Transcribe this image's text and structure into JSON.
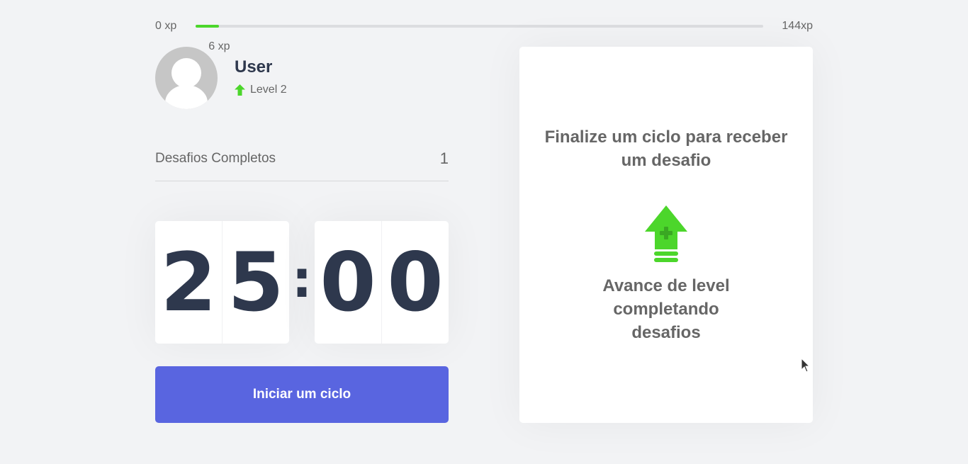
{
  "xp": {
    "min_label": "0 xp",
    "max_label": "144xp",
    "current_label": "6 xp",
    "current": 6,
    "max": 144,
    "accent_color": "#4cd62b"
  },
  "profile": {
    "name": "User",
    "level_label": "Level 2",
    "icon": "level-up-arrow-icon"
  },
  "challenges": {
    "label": "Desafios Completos",
    "count": "1"
  },
  "countdown": {
    "minute_left": "2",
    "minute_right": "5",
    "separator": ":",
    "second_left": "0",
    "second_right": "0"
  },
  "button": {
    "label": "Iniciar um ciclo",
    "color": "#5965e0"
  },
  "challenge_card": {
    "title": "Finalize um ciclo para receber um desafio",
    "subtitle": "Avance de level completando desafios",
    "icon": "level-up-icon"
  }
}
